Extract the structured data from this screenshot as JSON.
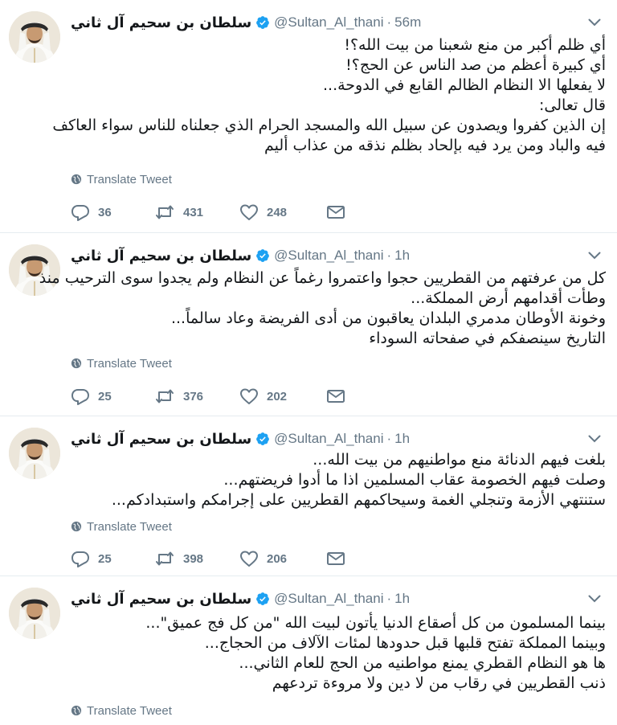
{
  "colors": {
    "text": "#14171a",
    "muted": "#657786",
    "verified": "#1da1f2",
    "divider": "#e6ecf0"
  },
  "icons": {
    "reply": "reply-icon",
    "retweet": "retweet-icon",
    "like": "heart-icon",
    "message": "envelope-icon",
    "translate": "globe-icon",
    "verified": "verified-badge-icon",
    "more": "chevron-down-icon"
  },
  "tweets": [
    {
      "fullname": "سلطان بن سحيم آل ثاني",
      "screen_name": "@Sultan_Al_thani",
      "separator": "·",
      "time": "56m",
      "lines": [
        "أي ظلم أكبر من منع شعبنا من بيت الله؟!",
        "أي كبيرة أعظم من صد الناس عن الحج؟!",
        "لا يفعلها الا النظام الظالم القابع في الدوحة...",
        "قال تعالى:",
        "إن الذين كفروا ويصدون عن سبيل الله والمسجد الحرام الذي جعلناه للناس سواء العاكف",
        "فيه والباد ومن يرد فيه بإلحاد بظلم نذقه من عذاب أليم"
      ],
      "translate_label": "Translate Tweet",
      "replies": "36",
      "retweets": "431",
      "likes": "248"
    },
    {
      "fullname": "سلطان بن سحيم آل ثاني",
      "screen_name": "@Sultan_Al_thani",
      "separator": "·",
      "time": "1h",
      "lines": [
        "كل من عرفتهم من القطريين حجوا واعتمروا رغماً عن النظام ولم يجدوا سوى الترحيب منذ",
        "وطأت أقدامهم أرض المملكة...",
        "وخونة الأوطان مدمري البلدان يعاقبون من أدى الفريضة وعاد سالماً...",
        "التاريخ سينصفكم في صفحاته السوداء"
      ],
      "translate_label": "Translate Tweet",
      "replies": "25",
      "retweets": "376",
      "likes": "202"
    },
    {
      "fullname": "سلطان بن سحيم آل ثاني",
      "screen_name": "@Sultan_Al_thani",
      "separator": "·",
      "time": "1h",
      "lines": [
        "بلغت فيهم الدنائة منع مواطنيهم من بيت الله...",
        "وصلت فيهم الخصومة عقاب المسلمين اذا ما أدوا فريضتهم...",
        "ستنتهي الأزمة وتنجلي الغمة وسيحاكمهم القطريين على إجرامكم واستبدادكم..."
      ],
      "translate_label": "Translate Tweet",
      "replies": "25",
      "retweets": "398",
      "likes": "206"
    },
    {
      "fullname": "سلطان بن سحيم آل ثاني",
      "screen_name": "@Sultan_Al_thani",
      "separator": "·",
      "time": "1h",
      "lines": [
        "بينما المسلمون من كل أصقاع الدنيا يأتون لبيت الله \"من كل فج عميق\"...",
        "وبينما المملكة تفتح قلبها قبل حدودها لمئات الآلاف من الحجاج...",
        "ها هو النظام القطري يمنع مواطنيه من الحج للعام الثاني...",
        "ذنب القطريين في رقاب من لا دين ولا مروءة تردعهم"
      ],
      "translate_label": "Translate Tweet"
    }
  ]
}
